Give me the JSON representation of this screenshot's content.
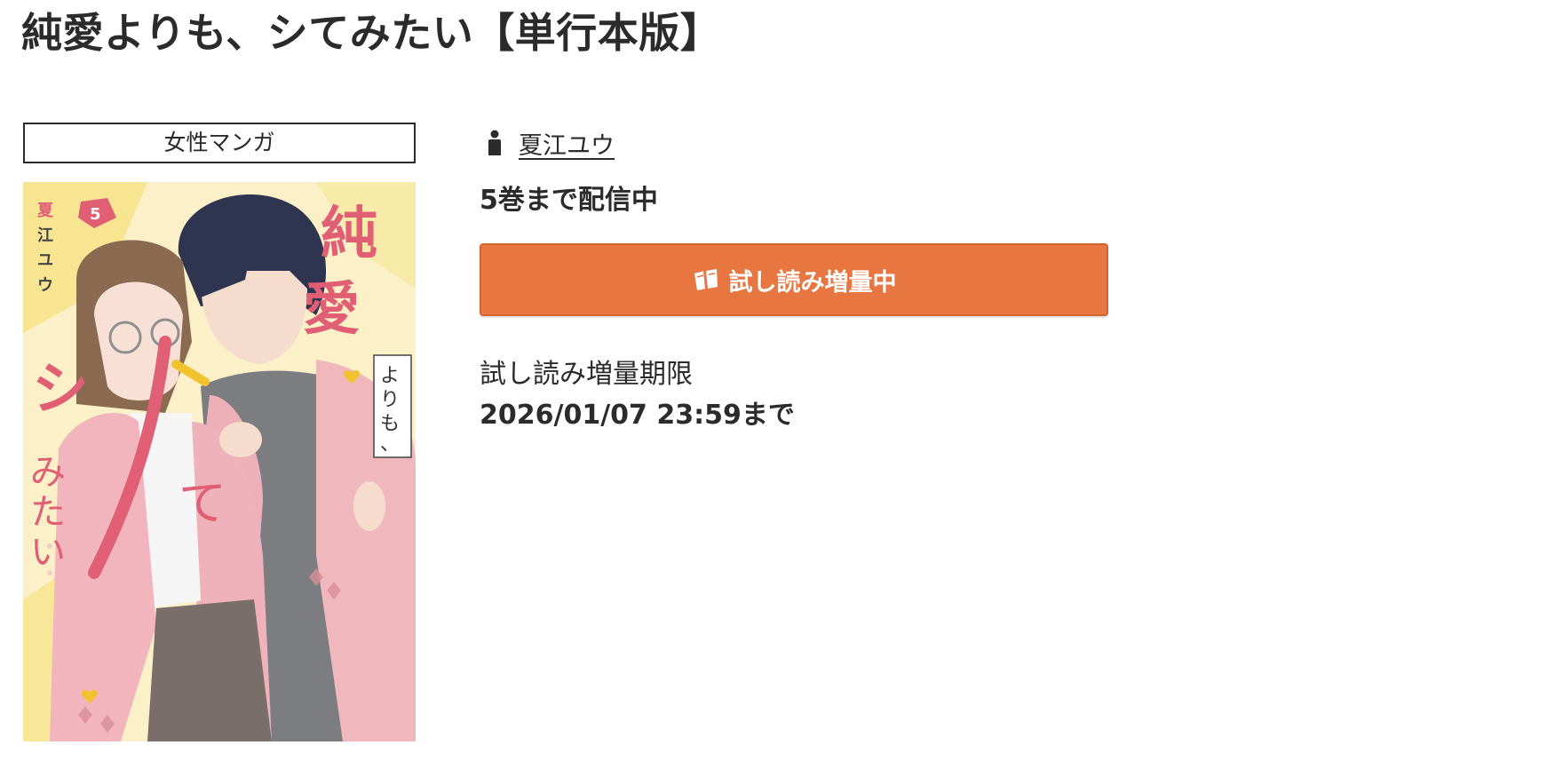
{
  "title": "純愛よりも、シてみたい【単行本版】",
  "genre_tag": "女性マンガ",
  "cover": {
    "title_text": "純愛よりも、シてみたい",
    "author_text": "夏江ユウ",
    "volume_number": "5"
  },
  "author": {
    "icon": "person-icon",
    "name": "夏江ユウ"
  },
  "volumes_status": "5巻まで配信中",
  "trial_button": {
    "icon": "open-book-icon",
    "label": "試し読み増量中",
    "color": "#e87640"
  },
  "trial_deadline": {
    "label": "試し読み増量期限",
    "value": "2026/01/07 23:59まで"
  }
}
